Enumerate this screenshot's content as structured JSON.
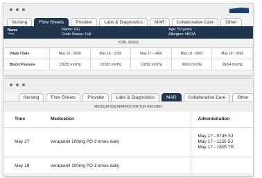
{
  "window1": {
    "tabs": [
      {
        "label": "Nursing",
        "active": false
      },
      {
        "label": "Flow Sheets",
        "active": true
      },
      {
        "label": "Provider",
        "active": false
      },
      {
        "label": "Labs & Diagnostics",
        "active": false
      },
      {
        "label": "MAR",
        "active": false
      },
      {
        "label": "Collaborative Care",
        "active": false
      },
      {
        "label": "Other",
        "active": false
      }
    ],
    "logo": {
      "line1": "Nurse",
      "line2": "Think"
    },
    "patient": {
      "name": "Name: GG",
      "code_status": "Code Status: Full",
      "age": "Age: 59 years",
      "allergies": "Allergies: NKDA"
    },
    "section_title": "VITAL SIGNS",
    "vitals": {
      "header_label": "Vitals / Date",
      "dates": [
        "May 16 - 2000",
        "May 16 - 2330",
        "May 17 - 0400",
        "May 18 - 0800",
        "May 18 - 0958"
      ],
      "row_label": "Blood Pressure",
      "values": [
        "126/83 mmHg",
        "130/82 mmHg",
        "116/82 mmHg",
        "98/62 mmHg",
        "96/64 mmHg"
      ]
    }
  },
  "window2": {
    "tabs": [
      {
        "label": "Nursing",
        "active": false
      },
      {
        "label": "Flow Sheets",
        "active": false
      },
      {
        "label": "Provider",
        "active": false
      },
      {
        "label": "Labs & Diagnostics",
        "active": false
      },
      {
        "label": "MAR",
        "active": true
      },
      {
        "label": "Collaborative Care",
        "active": false
      },
      {
        "label": "Other",
        "active": false
      }
    ],
    "section_title": "MEDICATION ADMINISTRATION RECORD",
    "headers": {
      "time": "Time",
      "medication": "Medication",
      "administration": "Administration"
    },
    "rows": [
      {
        "time": "May 17",
        "medication": "verapamil 100mg PO 3 times daily",
        "administration": [
          "May 17 - 0745 SJ",
          "May 17 - 1155 SJ",
          "May 17 - 1805 TR"
        ]
      },
      {
        "time": "May 18",
        "medication": "verapamil 100mg PO 3 times daily",
        "administration": []
      }
    ]
  },
  "colors": {
    "navy": "#22354f",
    "flag": "#1d3f6b"
  }
}
